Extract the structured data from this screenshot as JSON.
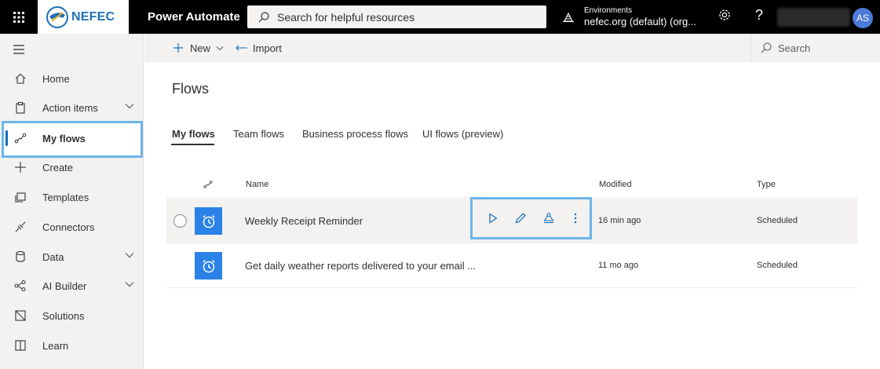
{
  "header": {
    "brand": "NEFEC",
    "app_name": "Power Automate",
    "search_placeholder": "Search for helpful resources",
    "environments_label": "Environments",
    "environment_value": "nefec.org (default) (org...",
    "help_label": "?",
    "avatar_initials": "AS"
  },
  "sidebar": {
    "items": [
      {
        "label": "Home"
      },
      {
        "label": "Action items"
      },
      {
        "label": "My flows"
      },
      {
        "label": "Create"
      },
      {
        "label": "Templates"
      },
      {
        "label": "Connectors"
      },
      {
        "label": "Data"
      },
      {
        "label": "AI Builder"
      },
      {
        "label": "Solutions"
      },
      {
        "label": "Learn"
      }
    ]
  },
  "command_bar": {
    "new_label": "New",
    "import_label": "Import",
    "search_label": "Search"
  },
  "main": {
    "title": "Flows",
    "tabs": [
      {
        "label": "My flows"
      },
      {
        "label": "Team flows"
      },
      {
        "label": "Business process flows"
      },
      {
        "label": "UI flows (preview)"
      }
    ],
    "columns": {
      "name": "Name",
      "modified": "Modified",
      "type": "Type"
    },
    "rows": [
      {
        "name": "Weekly Receipt Reminder",
        "modified": "16 min ago",
        "type": "Scheduled"
      },
      {
        "name": "Get daily weather reports delivered to your email ...",
        "modified": "11 mo ago",
        "type": "Scheduled"
      }
    ]
  },
  "colors": {
    "accent": "#0f6cbd",
    "flow_icon_bg": "#2b82e6",
    "highlight": "#6cb4e8",
    "topbar": "#000000"
  }
}
